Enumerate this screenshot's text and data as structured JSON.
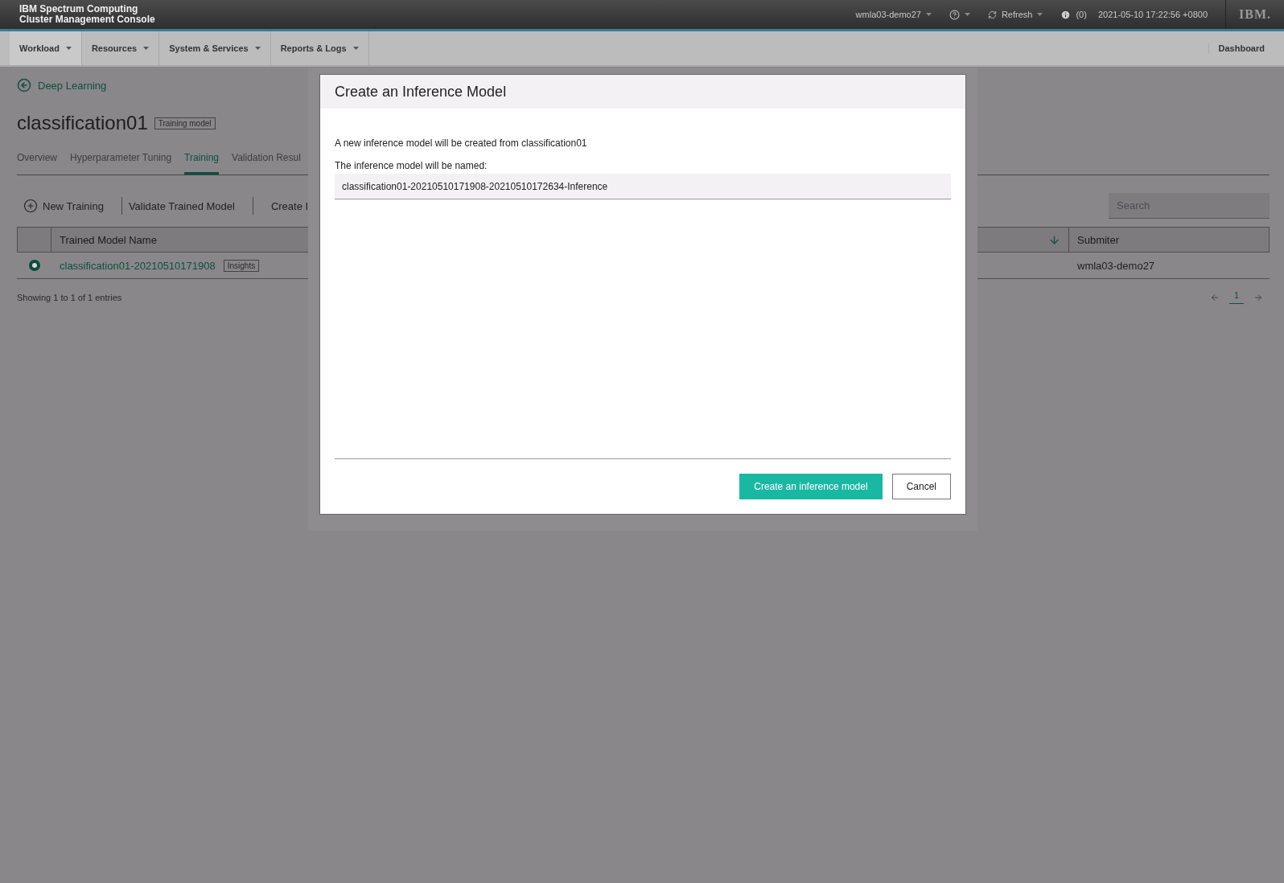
{
  "header": {
    "product_lines": [
      "IBM Spectrum Computing",
      "Cluster Management Console"
    ],
    "user": "wmla03-demo27",
    "refresh": "Refresh",
    "alerts": "(0)",
    "datetime": "2021-05-10 17:22:56 +0800",
    "logo": "IBM."
  },
  "nav": {
    "items": [
      {
        "label": "Workload",
        "selected": true
      },
      {
        "label": "Resources",
        "selected": false
      },
      {
        "label": "System & Services",
        "selected": false
      },
      {
        "label": "Reports & Logs",
        "selected": false
      }
    ],
    "right": "Dashboard"
  },
  "page": {
    "back_link": "Deep Learning",
    "title": "classification01",
    "badge": "Training model",
    "tabs": [
      {
        "label": "Overview",
        "selected": false
      },
      {
        "label": "Hyperparameter Tuning",
        "selected": false
      },
      {
        "label": "Training",
        "selected": true
      },
      {
        "label": "Validation Resul",
        "selected": false
      }
    ],
    "toolbar": [
      {
        "kind": "add",
        "label": "New Training"
      },
      {
        "kind": "plain",
        "label": "Validate Trained Model"
      },
      {
        "kind": "plain",
        "label": "Create I"
      }
    ],
    "search": {
      "placeholder": "Search"
    },
    "table": {
      "columns": [
        "Trained Model Name",
        "Submiter"
      ],
      "rows": [
        {
          "selected": true,
          "name": "classification01-20210510171908",
          "tag": "Insights",
          "submitter": "wmla03-demo27"
        }
      ]
    },
    "footer": "Showing 1 to 1 of 1 entries",
    "pagination": {
      "page": "1"
    }
  },
  "dialog": {
    "title": "Create an Inference Model",
    "message": "A new inference model will be created from classification01",
    "field_label": "The inference model will be named:",
    "field_value": "classification01-20210510171908-20210510172634-Inference",
    "buttons": [
      {
        "kind": "primary",
        "label": "Create an inference model"
      },
      {
        "kind": "secondary",
        "label": "Cancel"
      }
    ]
  }
}
